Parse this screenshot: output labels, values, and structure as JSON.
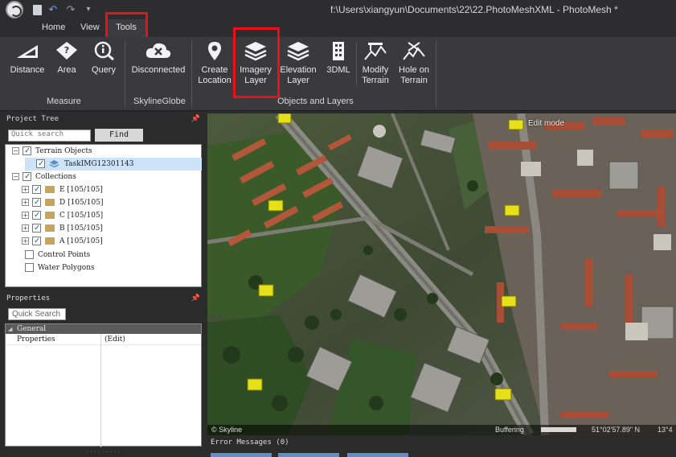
{
  "window": {
    "title": "f:\\Users\\xiangyun\\Documents\\22\\22.PhotoMeshXML - PhotoMesh *"
  },
  "tabs": [
    {
      "label": "Home"
    },
    {
      "label": "View"
    },
    {
      "label": "Tools",
      "selected": true
    }
  ],
  "ribbon": {
    "groups": [
      {
        "label": "Measure",
        "buttons": [
          {
            "label": "Distance",
            "icon": "ruler-triangle-icon"
          },
          {
            "label": "Area",
            "icon": "area-icon"
          },
          {
            "label": "Query",
            "icon": "query-info-icon"
          }
        ]
      },
      {
        "label": "SkylineGlobe",
        "buttons": [
          {
            "label": "Disconnected",
            "icon": "cloud-disconnected-icon"
          }
        ]
      },
      {
        "label": "Objects and Layers",
        "buttons": [
          {
            "label": "Create Location",
            "line1": "Create",
            "line2": "Location",
            "icon": "location-pin-icon"
          },
          {
            "label": "Imagery Layer",
            "line1": "Imagery",
            "line2": "Layer",
            "icon": "imagery-layers-icon",
            "highlighted": true
          },
          {
            "label": "Elevation Layer",
            "line1": "Elevation",
            "line2": "Layer",
            "icon": "elevation-layers-icon"
          },
          {
            "label": "3DML",
            "icon": "3dml-building-icon"
          },
          {
            "label": "Modify Terrain",
            "line1": "Modify",
            "line2": "Terrain",
            "icon": "modify-terrain-icon"
          },
          {
            "label": "Hole on Terrain",
            "line1": "Hole on",
            "line2": "Terrain",
            "icon": "hole-terrain-icon"
          }
        ]
      }
    ]
  },
  "project_tree": {
    "title": "Project Tree",
    "search_placeholder": "Quick search",
    "find_label": "Find",
    "items": [
      {
        "label": "Terrain Objects",
        "level": 0,
        "toggle": "−",
        "checked": true
      },
      {
        "label": "TaskIMG12301143",
        "level": 1,
        "checked": true,
        "selected": true,
        "icon": "layer-icon"
      },
      {
        "label": "Collections",
        "level": 0,
        "toggle": "−",
        "checked": true
      },
      {
        "label": "E [105/105]",
        "level": 1,
        "toggle": "+",
        "checked": true,
        "icon": "folder-icon"
      },
      {
        "label": "D [105/105]",
        "level": 1,
        "toggle": "+",
        "checked": true,
        "icon": "folder-icon"
      },
      {
        "label": "C [105/105]",
        "level": 1,
        "toggle": "+",
        "checked": true,
        "icon": "folder-icon"
      },
      {
        "label": "B [105/105]",
        "level": 1,
        "toggle": "+",
        "checked": true,
        "icon": "folder-icon"
      },
      {
        "label": "A [105/105]",
        "level": 1,
        "toggle": "+",
        "checked": true,
        "icon": "folder-icon"
      },
      {
        "label": "Control Points",
        "level": 0,
        "checked": false
      },
      {
        "label": "Water Polygons",
        "level": 0,
        "checked": false
      }
    ]
  },
  "properties": {
    "title": "Properties",
    "search_placeholder": "Quick Search",
    "category": "General",
    "rows": [
      {
        "name": "Properties",
        "value": "(Edit)"
      }
    ]
  },
  "map": {
    "edit_mode_label": "Edit mode",
    "copyright": "© Skyline",
    "buffering_label": "Buffering",
    "coordinate": "51°02'57.89\" N",
    "coordinate_partial": "13°4"
  },
  "error_messages": {
    "label": "Error Messages (0)"
  },
  "colors": {
    "highlight_box": "#e8111a",
    "accent": "#5d8fcf"
  }
}
